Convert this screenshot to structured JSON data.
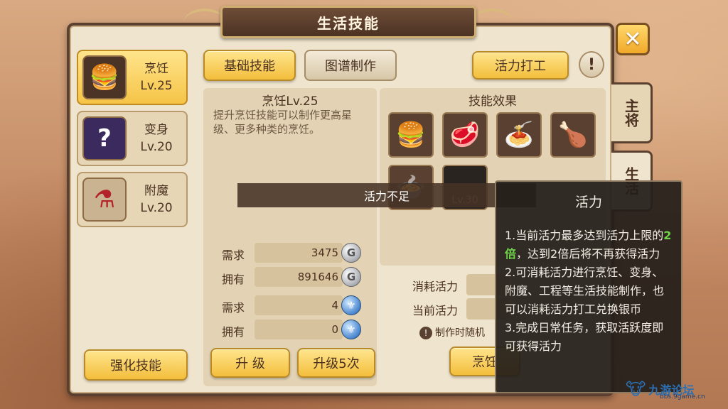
{
  "window": {
    "title": "生活技能",
    "close_label": "✕"
  },
  "skills": [
    {
      "name": "烹饪",
      "level": "Lv.25",
      "icon": "burger-icon",
      "glyph": "🍔",
      "active": true
    },
    {
      "name": "变身",
      "level": "Lv.20",
      "icon": "mystery-card-icon",
      "glyph": "?",
      "active": false
    },
    {
      "name": "附魔",
      "level": "Lv.20",
      "icon": "potion-icon",
      "glyph": "⚗",
      "active": false
    }
  ],
  "enhance_button": "强化技能",
  "tabs": {
    "basic": "基础技能",
    "recipe": "图谱制作",
    "work": "活力打工",
    "info_icon": "!"
  },
  "side_tabs": {
    "main": "主将",
    "life": "生活"
  },
  "detail": {
    "title": "烹饪Lv.25",
    "description": "提升烹饪技能可以制作更高星级、更多种类的烹饪。",
    "stats": [
      {
        "label": "需求",
        "value": "3475",
        "coin": "G",
        "coin_type": "silver"
      },
      {
        "label": "拥有",
        "value": "891646",
        "coin": "G",
        "coin_type": "silver"
      },
      {
        "label": "需求",
        "value": "4",
        "coin": "⚜",
        "coin_type": "blue"
      },
      {
        "label": "拥有",
        "value": "0",
        "coin": "⚜",
        "coin_type": "blue"
      }
    ],
    "upgrade_button": "升 级",
    "upgrade5_button": "升级5次"
  },
  "effects": {
    "title": "技能效果",
    "foods": [
      {
        "icon": "burger-icon",
        "glyph": "🍔"
      },
      {
        "icon": "steak-icon",
        "glyph": "🥩"
      },
      {
        "icon": "pasta-icon",
        "glyph": "🍝"
      },
      {
        "icon": "roast-chicken-icon",
        "glyph": "🍗"
      },
      {
        "icon": "stew-icon",
        "glyph": "🍲"
      },
      {
        "icon": "locked-dish-icon",
        "glyph": "Lv.30"
      }
    ]
  },
  "toast": "活力不足",
  "vitality": {
    "consume_label": "消耗活力",
    "current_label": "当前活力",
    "note": "制作时随机",
    "cook_button": "烹饪"
  },
  "tooltip": {
    "title": "活力",
    "line1_pre": "1.当前活力最多达到活力上限的",
    "line1_hl": "2倍",
    "line1_post": "，达到2倍后将不再获得活力",
    "line2": "2.可消耗活力进行烹饪、变身、附魔、工程等生活技能制作，也可以消耗活力打工兑换银币",
    "line3": "3.完成日常任务，获取活跃度即可获得活力"
  },
  "watermark": {
    "text": "九游论坛",
    "sub": "bbs.9game.cn"
  }
}
